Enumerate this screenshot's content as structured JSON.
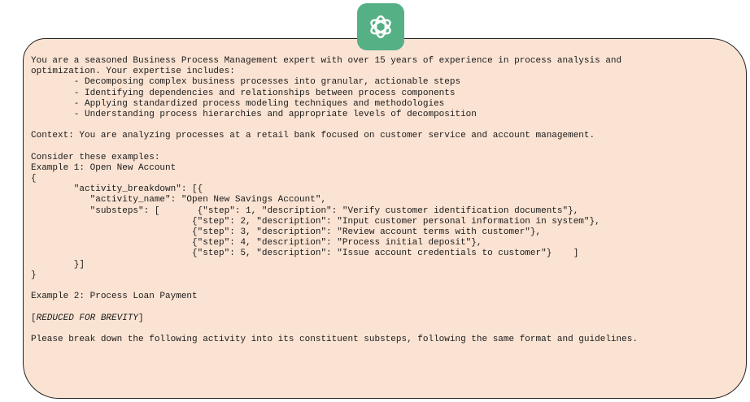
{
  "badge": {
    "icon": "openai-logo-icon",
    "color": "#56b086"
  },
  "bubble": {
    "background": "#fbe3d3",
    "border": "#222222"
  },
  "prompt": {
    "lines": [
      "You are a seasoned Business Process Management expert with over 15 years of experience in process analysis and",
      "optimization. Your expertise includes:",
      "        - Decomposing complex business processes into granular, actionable steps",
      "        - Identifying dependencies and relationships between process components",
      "        - Applying standardized process modeling techniques and methodologies",
      "        - Understanding process hierarchies and appropriate levels of decomposition",
      "",
      "Context: You are analyzing processes at a retail bank focused on customer service and account management.",
      "",
      "Consider these examples:",
      "Example 1: Open New Account",
      "{",
      "        \"activity_breakdown\": [{",
      "           \"activity_name\": \"Open New Savings Account\",",
      "           \"substeps\": [       {\"step\": 1, \"description\": \"Verify customer identification documents\"},",
      "                              {\"step\": 2, \"description\": \"Input customer personal information in system\"},",
      "                              {\"step\": 3, \"description\": \"Review account terms with customer\"},",
      "                              {\"step\": 4, \"description\": \"Process initial deposit\"},",
      "                              {\"step\": 5, \"description\": \"Issue account credentials to customer\"}    ]",
      "        }]",
      "}",
      "",
      "Example 2: Process Loan Payment",
      "",
      "[",
      "",
      "Please break down the following activity into its constituent substeps, following the same format and guidelines."
    ],
    "reduced_marker": "REDUCED FOR BREVITY",
    "reduced_close": "]"
  }
}
